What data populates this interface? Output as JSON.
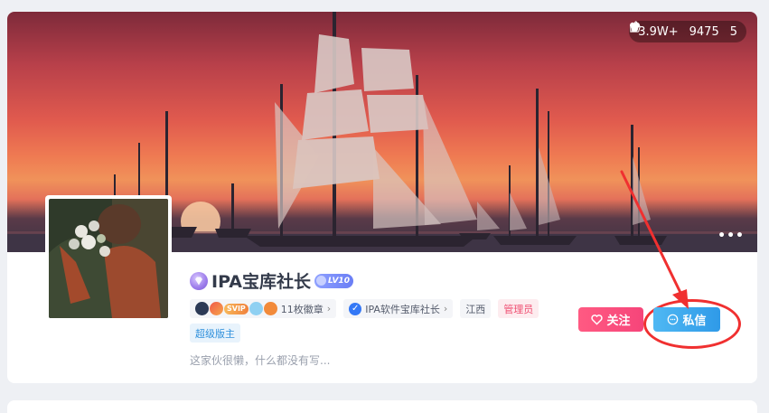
{
  "banner": {
    "stats": {
      "views": "3.9W+",
      "likes": "9475",
      "favorites": "5"
    },
    "more_label": "•••"
  },
  "profile": {
    "username": "IPA宝库社长",
    "level": "LV10",
    "badges_label": "11枚徽章",
    "svip_label": "SVIP",
    "verified_label": "IPA软件宝库社长",
    "location": "江西",
    "role_admin": "管理员",
    "role_moderator": "超级版主",
    "bio": "这家伙很懒，什么都没有写..."
  },
  "actions": {
    "follow_label": "关注",
    "message_label": "私信"
  },
  "colors": {
    "follow": "#f6457a",
    "message": "#2f9ae8",
    "annotation": "#f03030",
    "admin_tag": "#ef4f72",
    "moderator_tag": "#2f90dc"
  },
  "icons": {
    "views": "flame-icon",
    "likes": "thumbs-up-icon",
    "favorites": "heart-icon",
    "follow": "heart-outline-icon",
    "message": "chat-bubble-icon"
  }
}
